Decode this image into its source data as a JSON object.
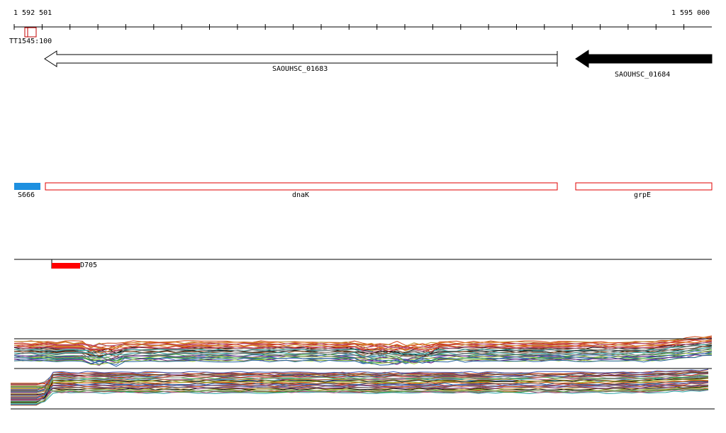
{
  "ruler": {
    "start_label": "1 592 501",
    "end_label": "1 595 000"
  },
  "terminator": {
    "label": "TT1545:100",
    "color": "#c00000"
  },
  "genes": [
    {
      "label": "SAOUHSC_01683",
      "strand": "reverse",
      "style": "outline"
    },
    {
      "label": "SAOUHSC_01684",
      "strand": "reverse",
      "style": "filled"
    }
  ],
  "annotations": [
    {
      "label": "S666",
      "color": "#1e90e0"
    },
    {
      "label": "dnaK",
      "color": "#e00000"
    },
    {
      "label": "grpE",
      "color": "#e00000"
    }
  ],
  "feature": {
    "label": "D705",
    "color": "#ff0000"
  },
  "colors": {
    "track_line": "#000000",
    "arrow_fill": "#000000"
  }
}
